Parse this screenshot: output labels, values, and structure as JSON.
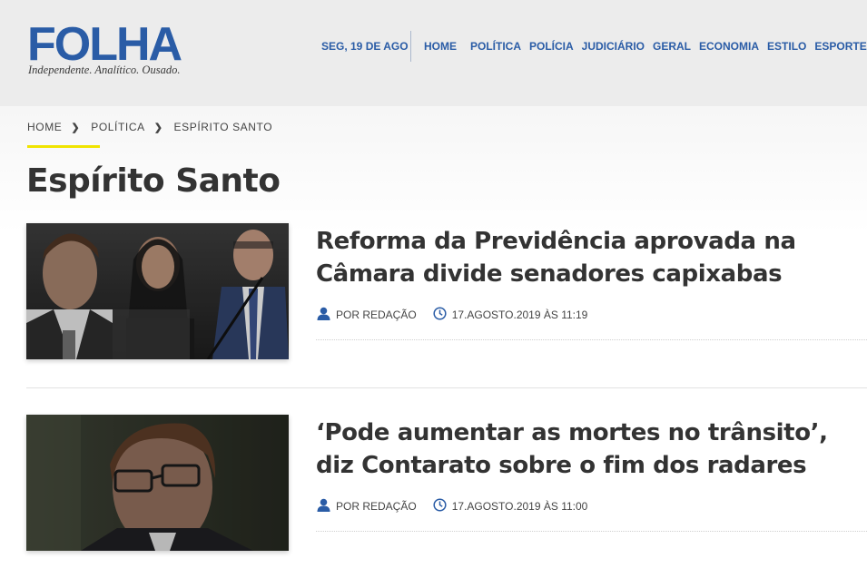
{
  "header": {
    "logo_text": "FOLHA",
    "tagline": "Independente. Analítico. Ousado.",
    "date": "SEG, 19 DE AGO",
    "nav": [
      "HOME",
      "POLÍTICA",
      "POLÍCIA",
      "JUDICIÁRIO",
      "GERAL",
      "ECONOMIA",
      "ESTILO",
      "ESPORTE"
    ]
  },
  "breadcrumb": [
    "HOME",
    "POLÍTICA",
    "ESPÍRITO SANTO"
  ],
  "page_title": "Espírito Santo",
  "articles": [
    {
      "headline": "Reforma da Previdência aprovada na Câmara divide senadores capixabas",
      "author": "POR REDAÇÃO",
      "datetime": "17.AGOSTO.2019 ÀS 11:19"
    },
    {
      "headline": "‘Pode aumentar as mortes no trânsito’, diz Contarato sobre o fim dos radares",
      "author": "POR REDAÇÃO",
      "datetime": "17.AGOSTO.2019 ÀS 11:00"
    }
  ],
  "colors": {
    "brand": "#2a5ca6",
    "accent_underline": "#f0e400",
    "header_bg": "#ececec",
    "text": "#333333"
  }
}
